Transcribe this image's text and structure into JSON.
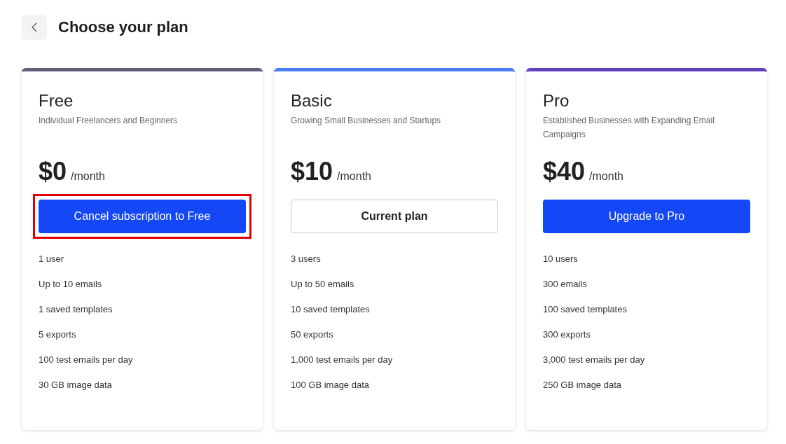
{
  "header": {
    "title": "Choose your plan"
  },
  "plans": [
    {
      "name": "Free",
      "description": "Individual Freelancers and Beginners",
      "price": "$0",
      "period": "/month",
      "color": "#5f5f77",
      "button": {
        "label": "Cancel subscription to Free",
        "kind": "primary",
        "highlighted": true
      },
      "features": [
        "1 user",
        "Up to 10 emails",
        "1 saved templates",
        "5 exports",
        "100 test emails per day",
        "30 GB image data"
      ]
    },
    {
      "name": "Basic",
      "description": "Growing Small Businesses and Startups",
      "price": "$10",
      "period": "/month",
      "color": "#4a7cf6",
      "button": {
        "label": "Current plan",
        "kind": "outline",
        "highlighted": false
      },
      "features": [
        "3 users",
        "Up to 50 emails",
        "10 saved templates",
        "50 exports",
        "1,000 test emails per day",
        "100 GB image data"
      ]
    },
    {
      "name": "Pro",
      "description": "Established Businesses with Expanding Email Campaigns",
      "price": "$40",
      "period": "/month",
      "color": "#6340bc",
      "button": {
        "label": "Upgrade to Pro",
        "kind": "primary",
        "highlighted": false
      },
      "features": [
        "10 users",
        "300 emails",
        "100 saved templates",
        "300 exports",
        "3,000 test emails per day",
        "250 GB image data"
      ]
    }
  ]
}
